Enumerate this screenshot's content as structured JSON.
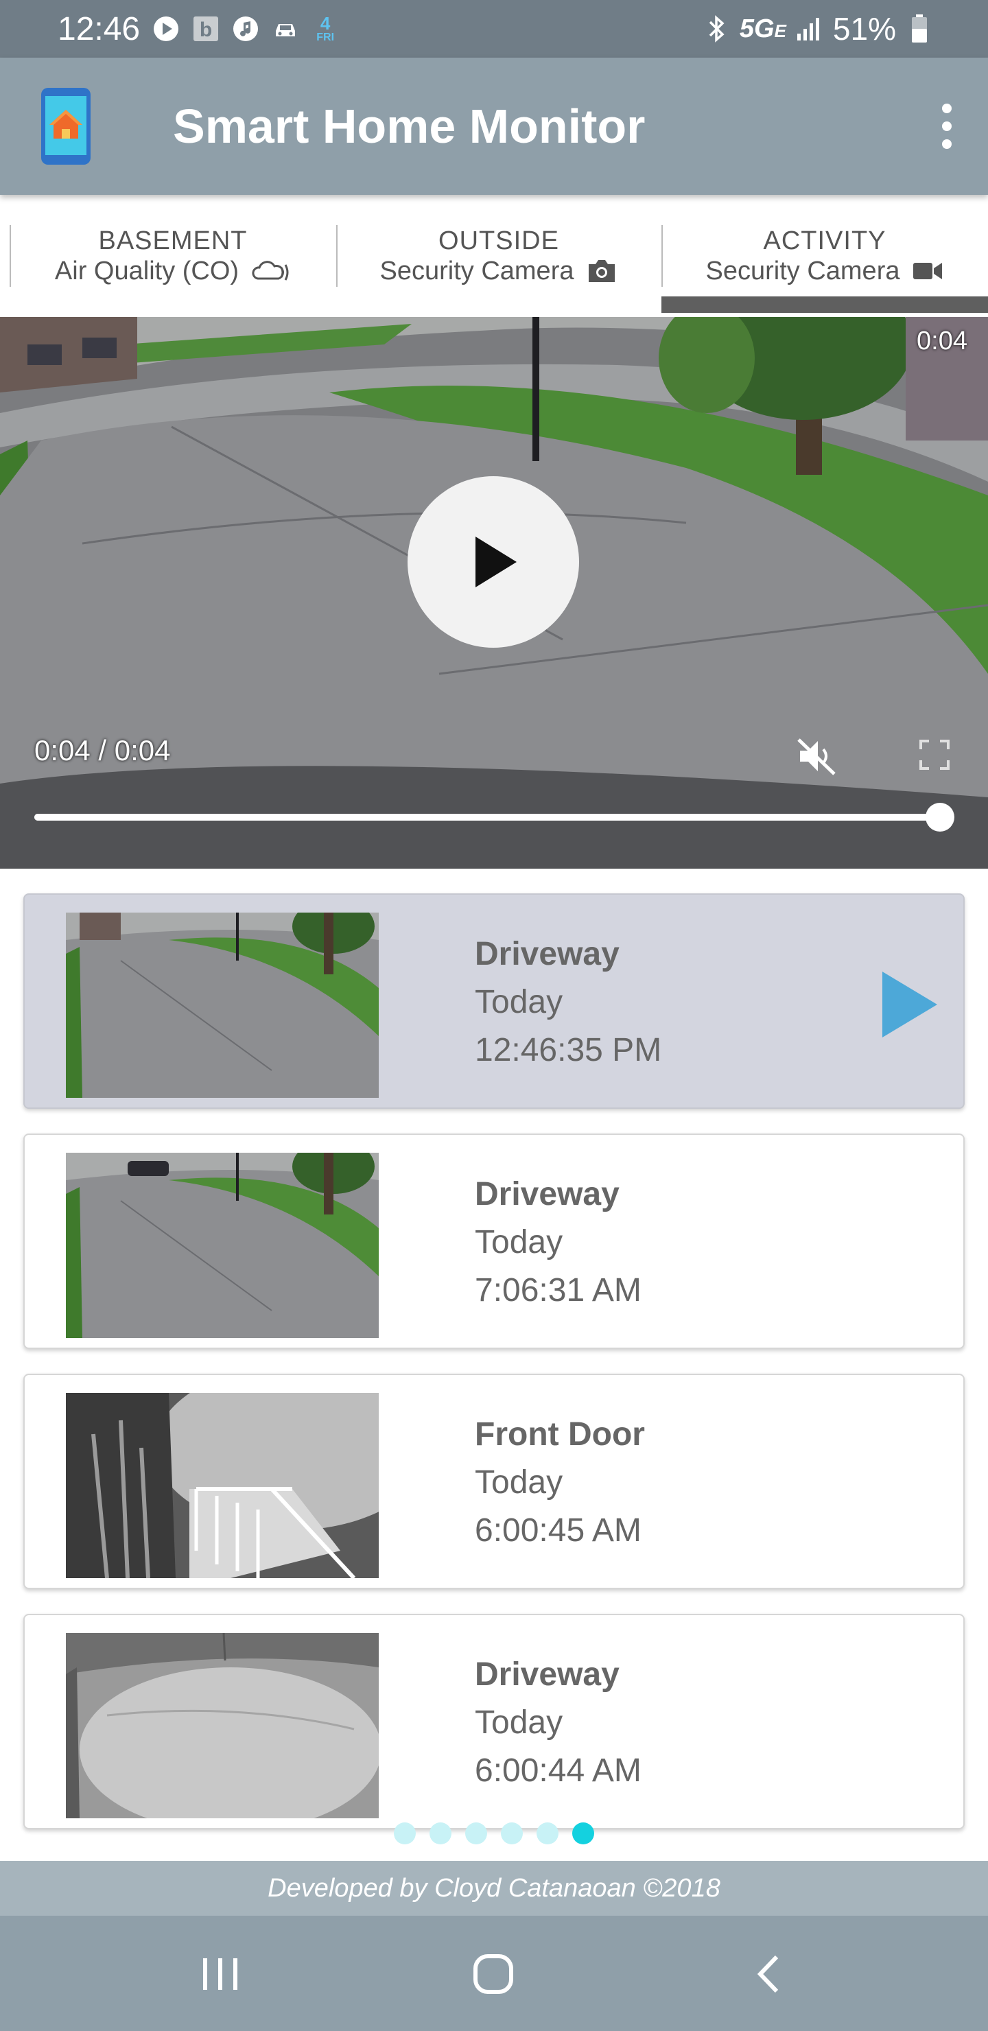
{
  "status_bar": {
    "time": "12:46",
    "calendar_day": "4",
    "calendar_weekday": "FRI",
    "network": "5G",
    "network_suffix": "E",
    "battery": "51%"
  },
  "app": {
    "title": "Smart Home Monitor"
  },
  "tabs": [
    {
      "title": "BASEMENT",
      "subtitle": "Air Quality (CO)",
      "icon": "cloud-sensor-icon"
    },
    {
      "title": "OUTSIDE",
      "subtitle": "Security Camera",
      "icon": "camera-icon"
    },
    {
      "title": "ACTIVITY",
      "subtitle": "Security Camera",
      "icon": "video-camera-icon"
    }
  ],
  "active_tab": 2,
  "video": {
    "duration_badge": "0:04",
    "time_display": "0:04 / 0:04",
    "progress": 1.0
  },
  "events": [
    {
      "name": "Driveway",
      "day": "Today",
      "time": "12:46:35 PM",
      "active": true
    },
    {
      "name": "Driveway",
      "day": "Today",
      "time": "7:06:31 AM",
      "active": false
    },
    {
      "name": "Front Door",
      "day": "Today",
      "time": "6:00:45 AM",
      "active": false
    },
    {
      "name": "Driveway",
      "day": "Today",
      "time": "6:00:44 AM",
      "active": false
    }
  ],
  "pagination": {
    "total": 6,
    "current": 6
  },
  "footer": {
    "text": "Developed by Cloyd Catanaoan ©2018"
  },
  "colors": {
    "status_bar": "#707d87",
    "app_bar": "#8f9fa9",
    "accent_play": "#4da8d8",
    "dot_active": "#14d1df"
  }
}
